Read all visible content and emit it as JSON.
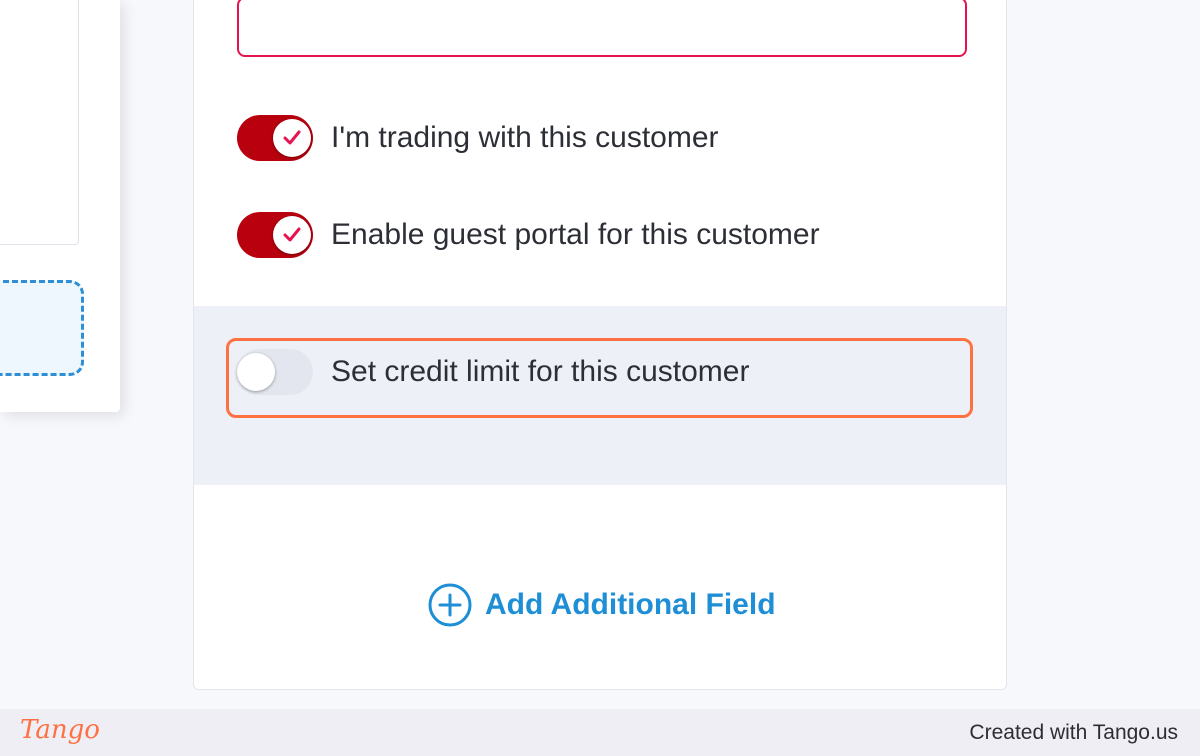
{
  "toggles": [
    {
      "label": "I'm trading with this customer",
      "state": "on"
    },
    {
      "label": "Enable guest portal for this customer",
      "state": "on"
    },
    {
      "label": "Set credit limit for this customer",
      "state": "off"
    }
  ],
  "add_field": {
    "label": "Add Additional Field",
    "icon": "plus-circle-icon"
  },
  "footer": {
    "logo": "Tango",
    "credit": "Created with Tango.us"
  },
  "colors": {
    "toggle_on": "#b8000e",
    "check": "#e5134f",
    "highlight": "#ff7043",
    "link": "#1e8ed6",
    "required_field_border": "#e5134f"
  }
}
